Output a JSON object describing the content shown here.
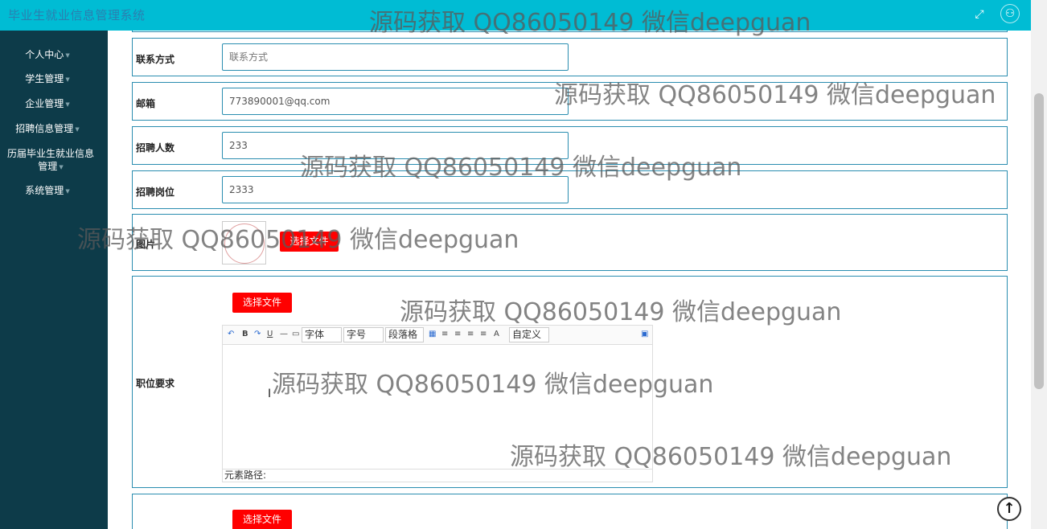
{
  "app": {
    "title": "毕业生就业信息管理系统"
  },
  "topbar": {
    "fullscreen_icon": "expand-icon",
    "user_icon": "user-icon"
  },
  "sidebar": {
    "items": [
      {
        "label": "个人中心"
      },
      {
        "label": "学生管理"
      },
      {
        "label": "企业管理"
      },
      {
        "label": "招聘信息管理"
      },
      {
        "label": "历届毕业生就业信息管理"
      },
      {
        "label": "系统管理"
      }
    ]
  },
  "form": {
    "contact": {
      "label": "联系方式",
      "placeholder": "联系方式",
      "value": ""
    },
    "email": {
      "label": "邮箱",
      "value": "773890001@qq.com"
    },
    "headcount": {
      "label": "招聘人数",
      "value": "233"
    },
    "position": {
      "label": "招聘岗位",
      "value": "2333"
    },
    "image": {
      "label": "图片",
      "button": "选择文件"
    },
    "requirements": {
      "label": "职位要求",
      "button": "选择文件",
      "editor": {
        "font_select": "字体",
        "size_select": "字号",
        "paragraph_select": "段落格",
        "custom_select": "自定义",
        "footer": "元素路径:"
      }
    },
    "next_row": {
      "button": "选择文件"
    }
  },
  "watermark": "源码获取 QQ86050149 微信deepguan",
  "colors": {
    "topbar": "#00bcd4",
    "sidebar": "#0d3b49",
    "accent_border": "#2a8db0",
    "button": "#ff0000"
  }
}
